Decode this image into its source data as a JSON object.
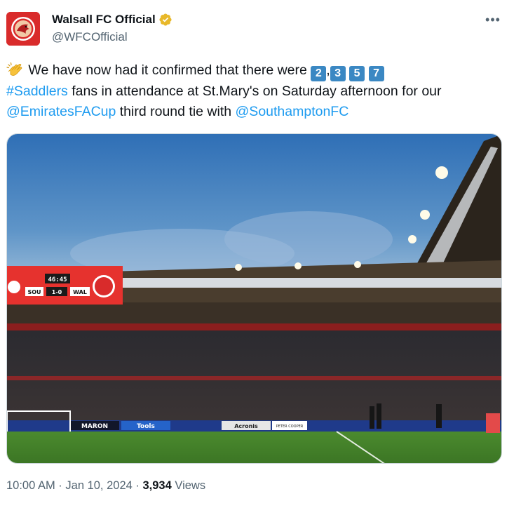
{
  "account": {
    "display_name": "Walsall FC Official",
    "handle": "@WFCOfficial",
    "verified": true,
    "avatar_icon": "walsall-crest-icon",
    "brand_color": "#d92b2b"
  },
  "tweet": {
    "intro_emoji": "clapping-hands-icon",
    "text_1": " We have now had it confirmed that there were ",
    "digits": [
      "2",
      "3",
      "5",
      "7"
    ],
    "comma": ",",
    "hashtag": "#Saddlers",
    "text_2": " fans in attendance at St.Mary's on Saturday afternoon for our ",
    "mention_1": "@EmiratesFACup",
    "text_3": " third round tie with ",
    "mention_2": "@SouthamptonFC",
    "link_color": "#1d9bf0"
  },
  "media": {
    "scoreboard": {
      "clock": "46:45",
      "home": "SOU",
      "score": "1-0",
      "away": "WAL"
    },
    "boards": [
      "MARON",
      "Tools",
      "Acronis",
      "PETER COOPER"
    ]
  },
  "meta": {
    "time": "10:00 AM",
    "separator_1": " · ",
    "date": "Jan 10, 2024",
    "separator_2": " · ",
    "views_count": "3,934",
    "views_label": " Views"
  },
  "more_icon": "more-options-icon"
}
